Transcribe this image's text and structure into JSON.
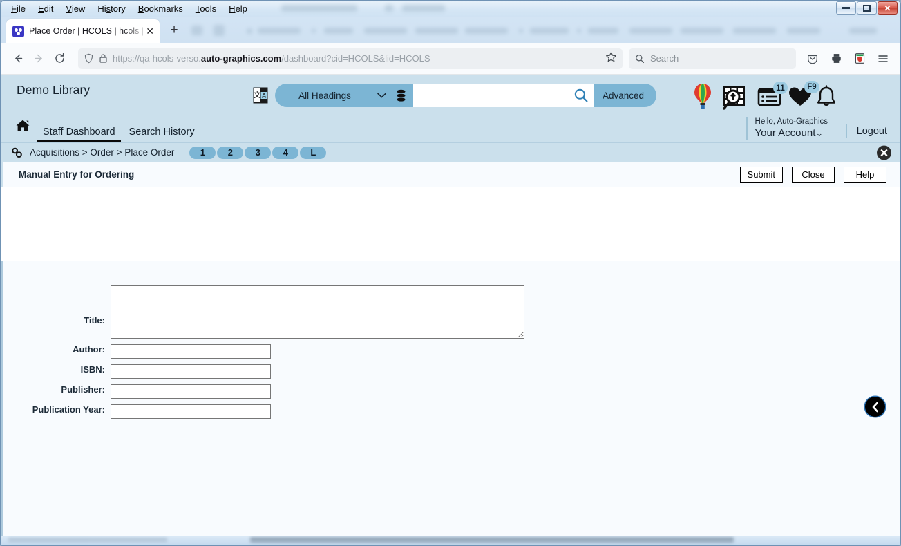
{
  "browser": {
    "menus": [
      "File",
      "Edit",
      "View",
      "History",
      "Bookmarks",
      "Tools",
      "Help"
    ],
    "window_controls": {
      "minimize": "minimize-button",
      "restore": "restore-button",
      "close": "close-button"
    },
    "tab": {
      "title": "Place Order | HCOLS | hcols | Au",
      "favicon_name": "hcols-favicon",
      "close_label": "✕"
    },
    "new_tab_label": "+",
    "nav": {
      "back_label": "back-button",
      "forward_label": "forward-button",
      "reload_label": "reload-button"
    },
    "url": {
      "prefix": "https://qa-hcols-verso.",
      "domain": "auto-graphics.com",
      "suffix": "/dashboard?cid=HCOLS&lid=HCOLS",
      "full": "https://qa-hcols-verso.auto-graphics.com/dashboard?cid=HCOLS&lid=HCOLS"
    },
    "search": {
      "placeholder": "Search"
    }
  },
  "site": {
    "library_name": "Demo Library",
    "search_bar": {
      "headings_label": "All Headings",
      "caret": "⌄",
      "query_value": "",
      "advanced_label": "Advanced"
    },
    "nav_tabs": [
      {
        "label": "Staff Dashboard",
        "active": true
      },
      {
        "label": "Search History",
        "active": false
      }
    ],
    "header_icons": [
      {
        "name": "balloon-icon"
      },
      {
        "name": "film-search-icon"
      },
      {
        "name": "list-icon",
        "badge": "11"
      },
      {
        "name": "heart-icon",
        "badge": "F9"
      },
      {
        "name": "bell-icon",
        "badge": ""
      }
    ],
    "account": {
      "greeting": "Hello, Auto-Graphics",
      "account_label": "Your Account",
      "caret": "⌄",
      "logout_label": "Logout"
    }
  },
  "breadcrumb": {
    "path": "Acquisitions > Order > Place Order",
    "steps": [
      "1",
      "2",
      "3",
      "4",
      "L"
    ],
    "close_label": "✖"
  },
  "form": {
    "title": "Manual Entry for Ordering",
    "buttons": [
      {
        "label": "Submit",
        "name": "submit-button"
      },
      {
        "label": "Close",
        "name": "close-button"
      },
      {
        "label": "Help",
        "name": "help-button"
      }
    ],
    "fields": [
      {
        "label": "Title:",
        "value": "",
        "placeholder": "",
        "type": "textarea",
        "name": "title-field"
      },
      {
        "label": "Author:",
        "value": "",
        "placeholder": "",
        "type": "text",
        "name": "author-field"
      },
      {
        "label": "ISBN:",
        "value": "",
        "placeholder": "",
        "type": "text",
        "name": "isbn-field"
      },
      {
        "label": "Publisher:",
        "value": "",
        "placeholder": "",
        "type": "text",
        "name": "publisher-field"
      },
      {
        "label": "Publication Year:",
        "value": "",
        "placeholder": "",
        "type": "text",
        "name": "publication-year-field"
      }
    ],
    "back_arrow_label": "❮"
  },
  "colors": {
    "header_blue": "#cbe0ec",
    "accent_blue": "#7cb5d4",
    "content_bg": "#f8fbfe",
    "active_tab_underline": "#0a0a0a",
    "badge_blue": "#9ccbe2"
  }
}
